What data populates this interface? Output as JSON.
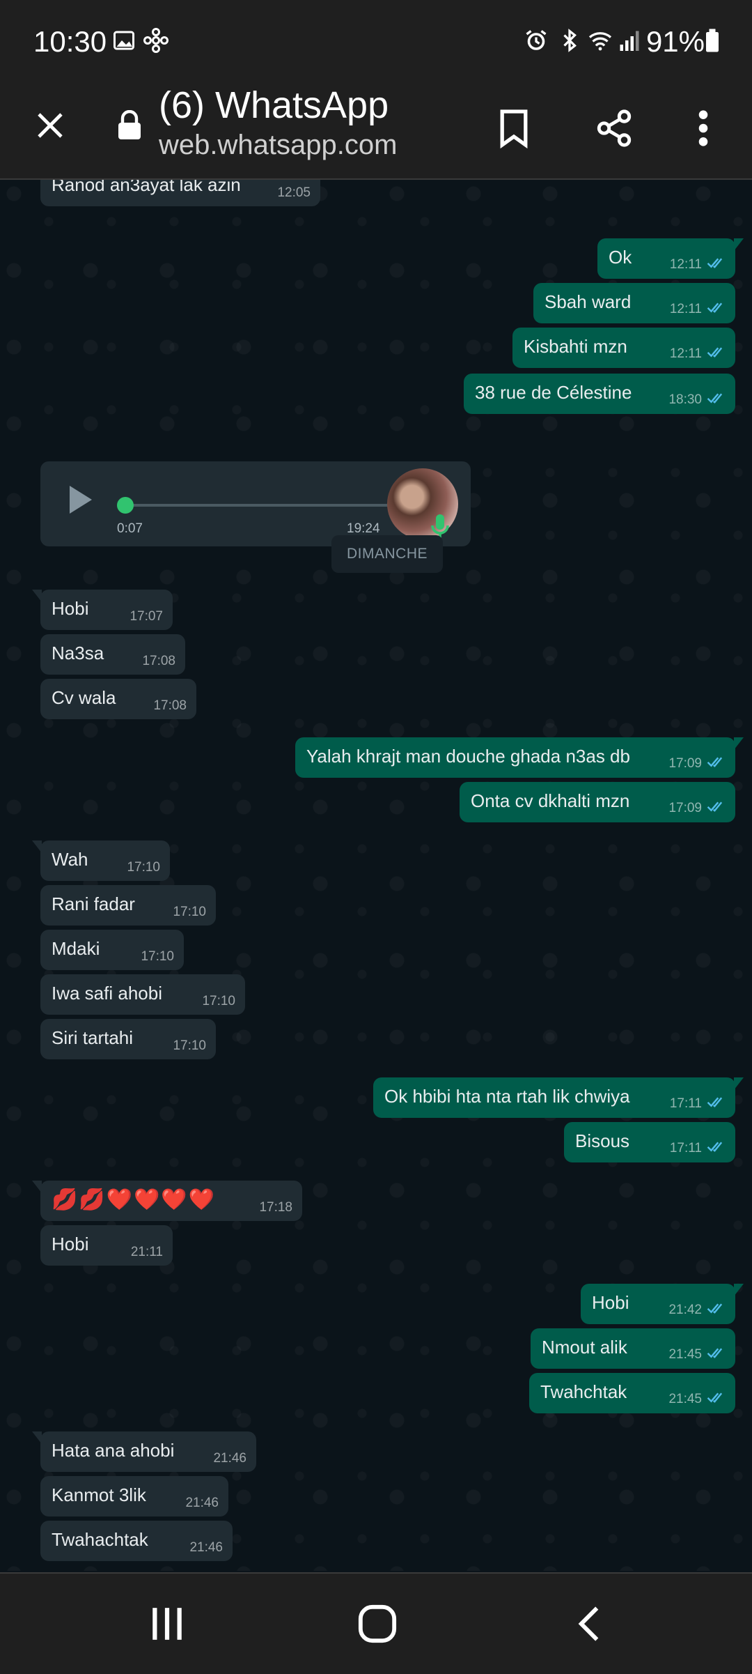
{
  "status": {
    "time": "10:30",
    "battery": "91%",
    "icons": [
      "gallery-icon",
      "settings-fan-icon",
      "alarm-icon",
      "bluetooth-icon",
      "wifi-icon",
      "signal-icon",
      "battery-icon"
    ]
  },
  "browser": {
    "title": "(6) WhatsApp",
    "url": "web.whatsapp.com",
    "icons": [
      "close-icon",
      "lock-icon",
      "bookmark-icon",
      "share-icon",
      "more-vert-icon"
    ]
  },
  "chat": {
    "day_divider": "DIMANCHE",
    "voice_note": {
      "duration": "0:07",
      "time": "19:24"
    },
    "messages": [
      {
        "dir": "in",
        "text": "Ranod an3ayat lak azin",
        "time": "12:05"
      },
      {
        "dir": "out",
        "text": "Ok",
        "time": "12:11"
      },
      {
        "dir": "out",
        "text": "Sbah ward",
        "time": "12:11"
      },
      {
        "dir": "out",
        "text": "Kisbahti mzn",
        "time": "12:11"
      },
      {
        "dir": "out",
        "text": "38 rue de Célestine",
        "time": "18:30"
      },
      {
        "dir": "in",
        "text": "Hobi",
        "time": "17:07"
      },
      {
        "dir": "in",
        "text": "Na3sa",
        "time": "17:08"
      },
      {
        "dir": "in",
        "text": "Cv wala",
        "time": "17:08"
      },
      {
        "dir": "out",
        "text": "Yalah khrajt man douche ghada n3as db",
        "time": "17:09"
      },
      {
        "dir": "out",
        "text": "Onta cv dkhalti mzn",
        "time": "17:09"
      },
      {
        "dir": "in",
        "text": "Wah",
        "time": "17:10"
      },
      {
        "dir": "in",
        "text": "Rani fadar",
        "time": "17:10"
      },
      {
        "dir": "in",
        "text": "Mdaki",
        "time": "17:10"
      },
      {
        "dir": "in",
        "text": "Iwa safi ahobi",
        "time": "17:10"
      },
      {
        "dir": "in",
        "text": "Siri tartahi",
        "time": "17:10"
      },
      {
        "dir": "out",
        "text": "Ok hbibi hta nta rtah lik chwiya",
        "time": "17:11"
      },
      {
        "dir": "out",
        "text": "Bisous",
        "time": "17:11"
      },
      {
        "dir": "in",
        "text": "💋💋❤️❤️❤️❤️",
        "time": "17:18"
      },
      {
        "dir": "in",
        "text": "Hobi",
        "time": "21:11"
      },
      {
        "dir": "out",
        "text": "Hobi",
        "time": "21:42"
      },
      {
        "dir": "out",
        "text": "Nmout alik",
        "time": "21:45"
      },
      {
        "dir": "out",
        "text": "Twahchtak",
        "time": "21:45"
      },
      {
        "dir": "in",
        "text": "Hata ana ahobi",
        "time": "21:46"
      },
      {
        "dir": "in",
        "text": "Kanmot 3lik",
        "time": "21:46"
      },
      {
        "dir": "in",
        "text": "Twahachtak",
        "time": "21:46"
      }
    ]
  },
  "navbar": {
    "icons": [
      "recent-apps-icon",
      "home-icon",
      "back-icon"
    ]
  },
  "colors": {
    "chat_bg": "#0b141a",
    "incoming_bubble": "#202c33",
    "outgoing_bubble": "#005c4b",
    "read_tick": "#53bdeb",
    "bar_bg": "#1f1f1f"
  }
}
